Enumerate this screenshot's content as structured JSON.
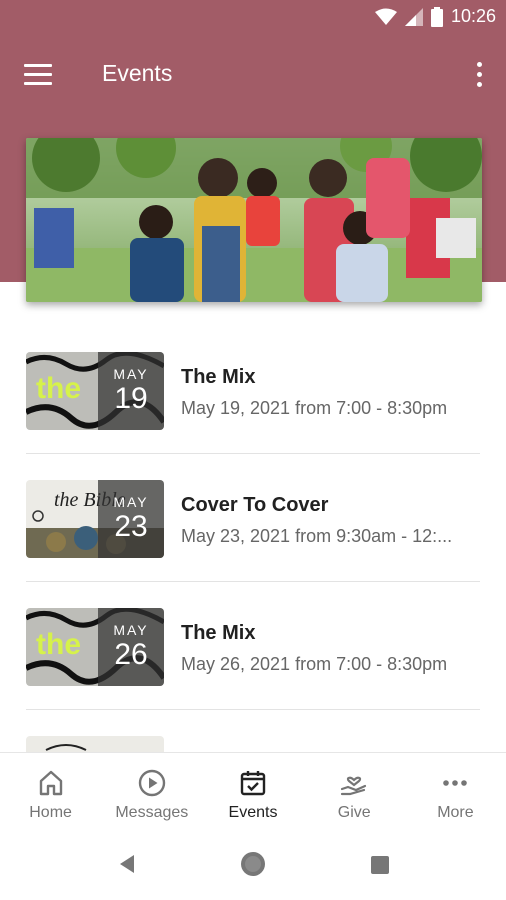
{
  "status_bar": {
    "time": "10:26"
  },
  "header": {
    "title": "Events"
  },
  "events": [
    {
      "title": "The Mix",
      "subtitle": "May 19, 2021 from 7:00 - 8:30pm",
      "month": "MAY",
      "day": "19",
      "thumb_text": "the"
    },
    {
      "title": "Cover To Cover",
      "subtitle": "May 23, 2021 from 9:30am - 12:...",
      "month": "MAY",
      "day": "23",
      "thumb_text": "the Bible"
    },
    {
      "title": "The Mix",
      "subtitle": "May 26, 2021 from 7:00 - 8:30pm",
      "month": "MAY",
      "day": "26",
      "thumb_text": "the"
    }
  ],
  "bottom_nav": [
    {
      "label": "Home",
      "icon": "home-icon"
    },
    {
      "label": "Messages",
      "icon": "play-circle-icon"
    },
    {
      "label": "Events",
      "icon": "calendar-icon",
      "active": true
    },
    {
      "label": "Give",
      "icon": "heart-hand-icon"
    },
    {
      "label": "More",
      "icon": "more-dots-icon"
    }
  ],
  "colors": {
    "brand": "#a25c67",
    "mix_accent": "#d6f24a"
  }
}
